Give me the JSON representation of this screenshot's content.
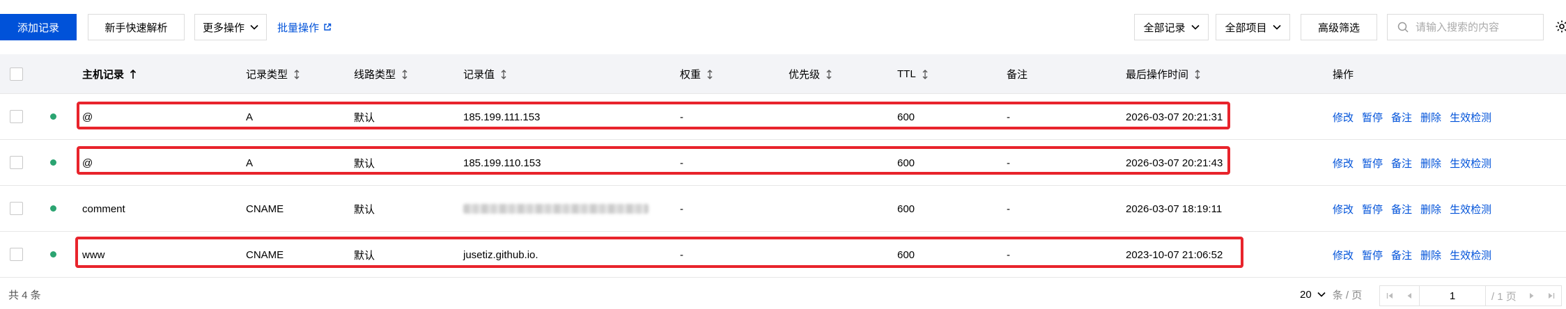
{
  "toolbar": {
    "add_record": "添加记录",
    "quick_resolve": "新手快速解析",
    "more_actions": "更多操作",
    "batch_actions": "批量操作",
    "filter_records": "全部记录",
    "filter_projects": "全部项目",
    "advanced_filter": "高级筛选",
    "search_placeholder": "请输入搜索的内容"
  },
  "table": {
    "headers": {
      "host": "主机记录",
      "type": "记录类型",
      "line": "线路类型",
      "value": "记录值",
      "weight": "权重",
      "priority": "优先级",
      "ttl": "TTL",
      "remark": "备注",
      "last_op_time": "最后操作时间",
      "actions": "操作"
    },
    "rows": [
      {
        "host": "@",
        "type": "A",
        "line": "默认",
        "value": "185.199.111.153",
        "weight": "-",
        "ttl": "600",
        "remark": "-",
        "time": "2026-03-07 20:21:31",
        "status": "enabled"
      },
      {
        "host": "@",
        "type": "A",
        "line": "默认",
        "value": "185.199.110.153",
        "weight": "-",
        "ttl": "600",
        "remark": "-",
        "time": "2026-03-07 20:21:43",
        "status": "enabled"
      },
      {
        "host": "comment",
        "type": "CNAME",
        "line": "默认",
        "value": "",
        "weight": "-",
        "ttl": "600",
        "remark": "-",
        "time": "2026-03-07 18:19:11",
        "status": "enabled"
      },
      {
        "host": "www",
        "type": "CNAME",
        "line": "默认",
        "value": "jusetiz.github.io.",
        "weight": "-",
        "ttl": "600",
        "remark": "-",
        "time": "2023-10-07 21:06:52",
        "status": "enabled"
      }
    ],
    "row_actions": {
      "edit": "修改",
      "pause": "暂停",
      "remark": "备注",
      "delete": "删除",
      "check": "生效检测"
    }
  },
  "footer": {
    "total": "共 4 条",
    "page_size": "20",
    "page_size_unit": "条 / 页",
    "current_page": "1",
    "total_pages": "/ 1 页"
  },
  "colors": {
    "accent": "#0052d9",
    "status_enabled": "#2ba471",
    "highlight": "#e8242c"
  }
}
